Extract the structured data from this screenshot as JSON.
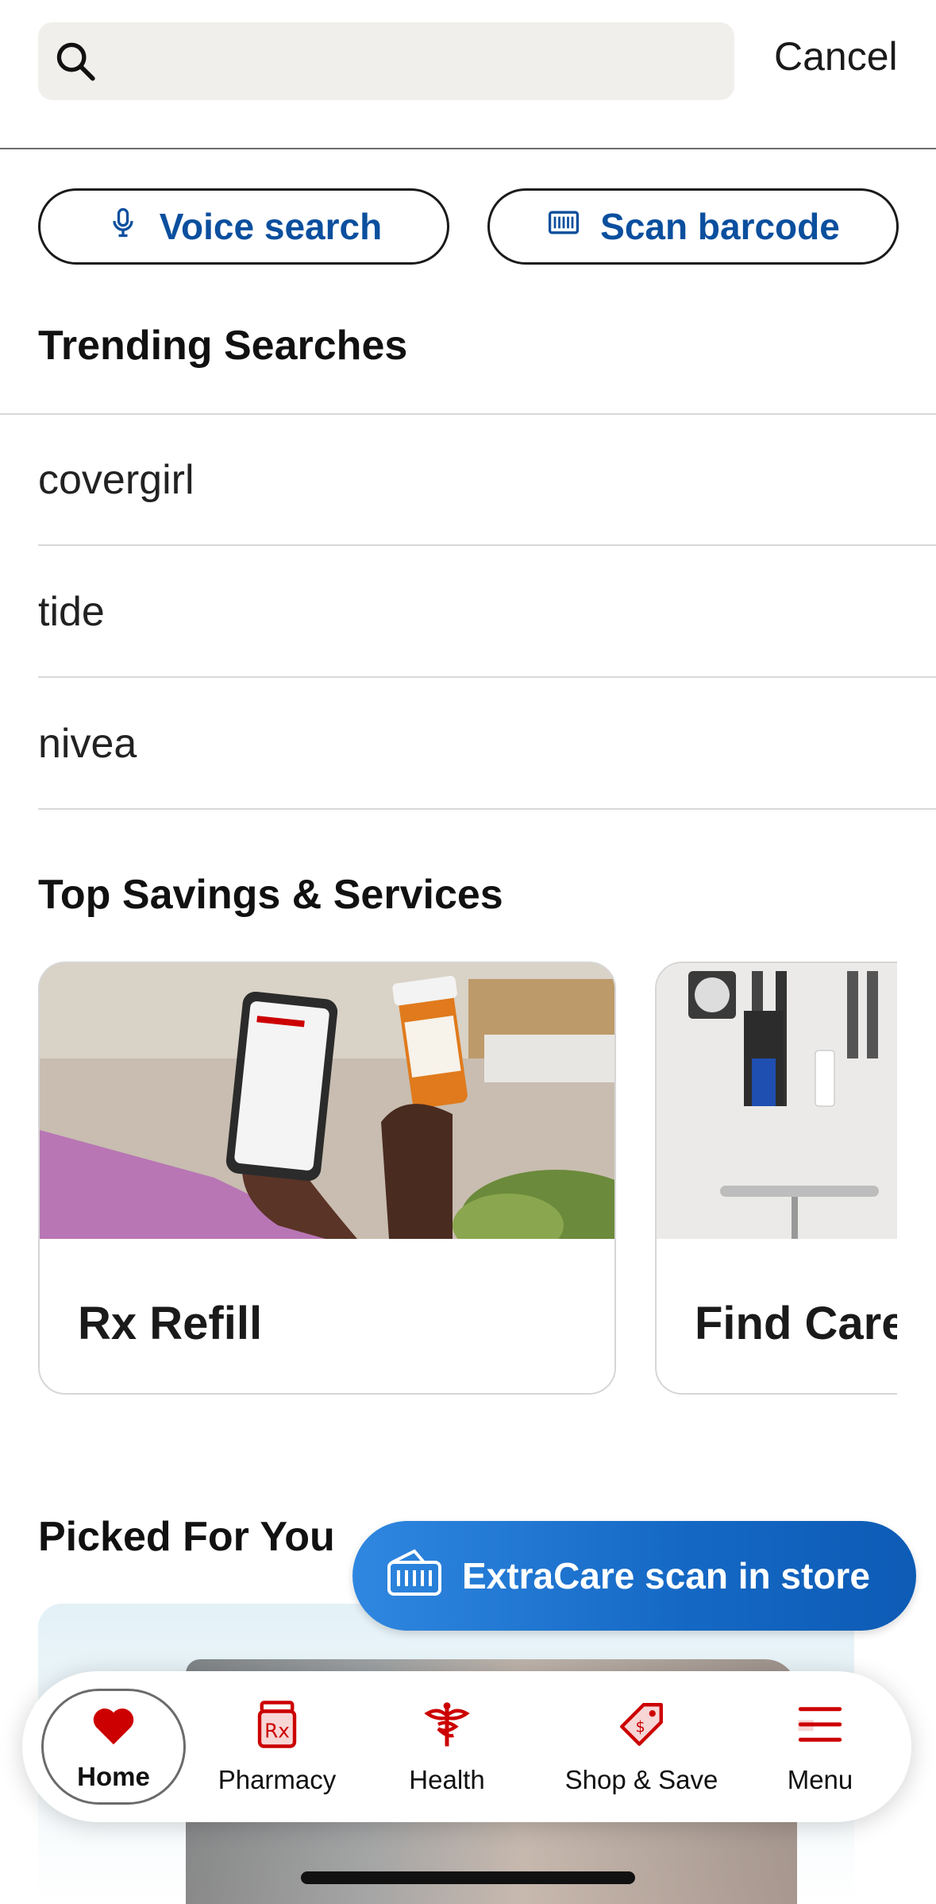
{
  "search": {
    "placeholder": "",
    "cancel_label": "Cancel",
    "voice_label": "Voice search",
    "scan_label": "Scan barcode"
  },
  "trending": {
    "title": "Trending Searches",
    "items": [
      "covergirl",
      "tide",
      "nivea"
    ]
  },
  "savings": {
    "title": "Top Savings & Services",
    "cards": [
      {
        "label": "Rx Refill"
      },
      {
        "label": "Find Care"
      }
    ]
  },
  "picked": {
    "title": "Picked For You"
  },
  "extracare": {
    "label": "ExtraCare scan in store"
  },
  "nav": {
    "items": [
      {
        "label": "Home",
        "icon": "heart-icon"
      },
      {
        "label": "Pharmacy",
        "icon": "rx-bottle-icon"
      },
      {
        "label": "Health",
        "icon": "health-caduceus-icon"
      },
      {
        "label": "Shop & Save",
        "icon": "price-tag-icon"
      },
      {
        "label": "Menu",
        "icon": "hamburger-menu-icon"
      }
    ]
  },
  "colors": {
    "brand_red": "#cc0000",
    "link_blue": "#0b4f9e",
    "button_blue": "#1468c4"
  }
}
